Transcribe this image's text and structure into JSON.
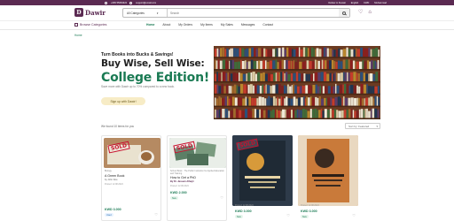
{
  "topbar": {
    "phone": "+965 55663322",
    "email": "support@email.com",
    "delivery": "Deliver in Kuwait",
    "language": "English",
    "currency": "KWD",
    "account": "Muhammad"
  },
  "header": {
    "logo_text": "Dawir",
    "logo_mark": "D",
    "search_category": "All Categories",
    "search_placeholder": "Search"
  },
  "nav": {
    "browse_label": "Browse Categories",
    "links": [
      "Home",
      "About",
      "My Orders",
      "My Items",
      "My Sales",
      "Messages",
      "Contact"
    ]
  },
  "breadcrumb": "Home",
  "hero": {
    "tagline": "Turn Books into Bucks & Savings!",
    "headline": "Buy Wise, Sell Wise:",
    "headline2": "College Edition!",
    "subtext": "Save more with Dawir up to 70% compared to a new book.",
    "cta": "Sign up with Dawir!"
  },
  "results": {
    "count_text": "We found 10 items for you",
    "sort_label": "Sort by: Featured"
  },
  "cards": [
    {
      "sold": "SOLD",
      "meta": "Biology",
      "title": "A Green Book",
      "author": "by John Doe",
      "date": "Posted: 12.08.2024",
      "price": "KWD 3.000",
      "badge": "Used",
      "colors": {
        "bg": "#b58a62"
      }
    },
    {
      "sold": "SOLD",
      "meta": "School Book · The Public Institution for Applied Education and Training",
      "title": "How to Get a PhD",
      "author": "By Dr. Jassem Alhajri",
      "date": "Posted: 12.08.2024",
      "price": "KWD 2.000",
      "badge": "New",
      "colors": {
        "bg": "#5c7f66"
      }
    },
    {
      "sold": "SOLD",
      "meta": "",
      "title": "",
      "author": "",
      "date": "Posted: 12.08.2024",
      "price": "KWD 3.000",
      "badge": "New",
      "colors": {
        "bg": "#2e3b4a"
      }
    },
    {
      "sold": "",
      "meta": "",
      "title": "",
      "author": "",
      "date": "Posted: 12.08.2024",
      "price": "KWD 3.000",
      "badge": "New",
      "colors": {
        "bg": "#c97a3a"
      }
    }
  ],
  "colors": {
    "brand": "#5b2a52",
    "accent_green": "#1a7a53",
    "sold_red": "#c8102e",
    "cta_bg": "#f7ecc6"
  }
}
